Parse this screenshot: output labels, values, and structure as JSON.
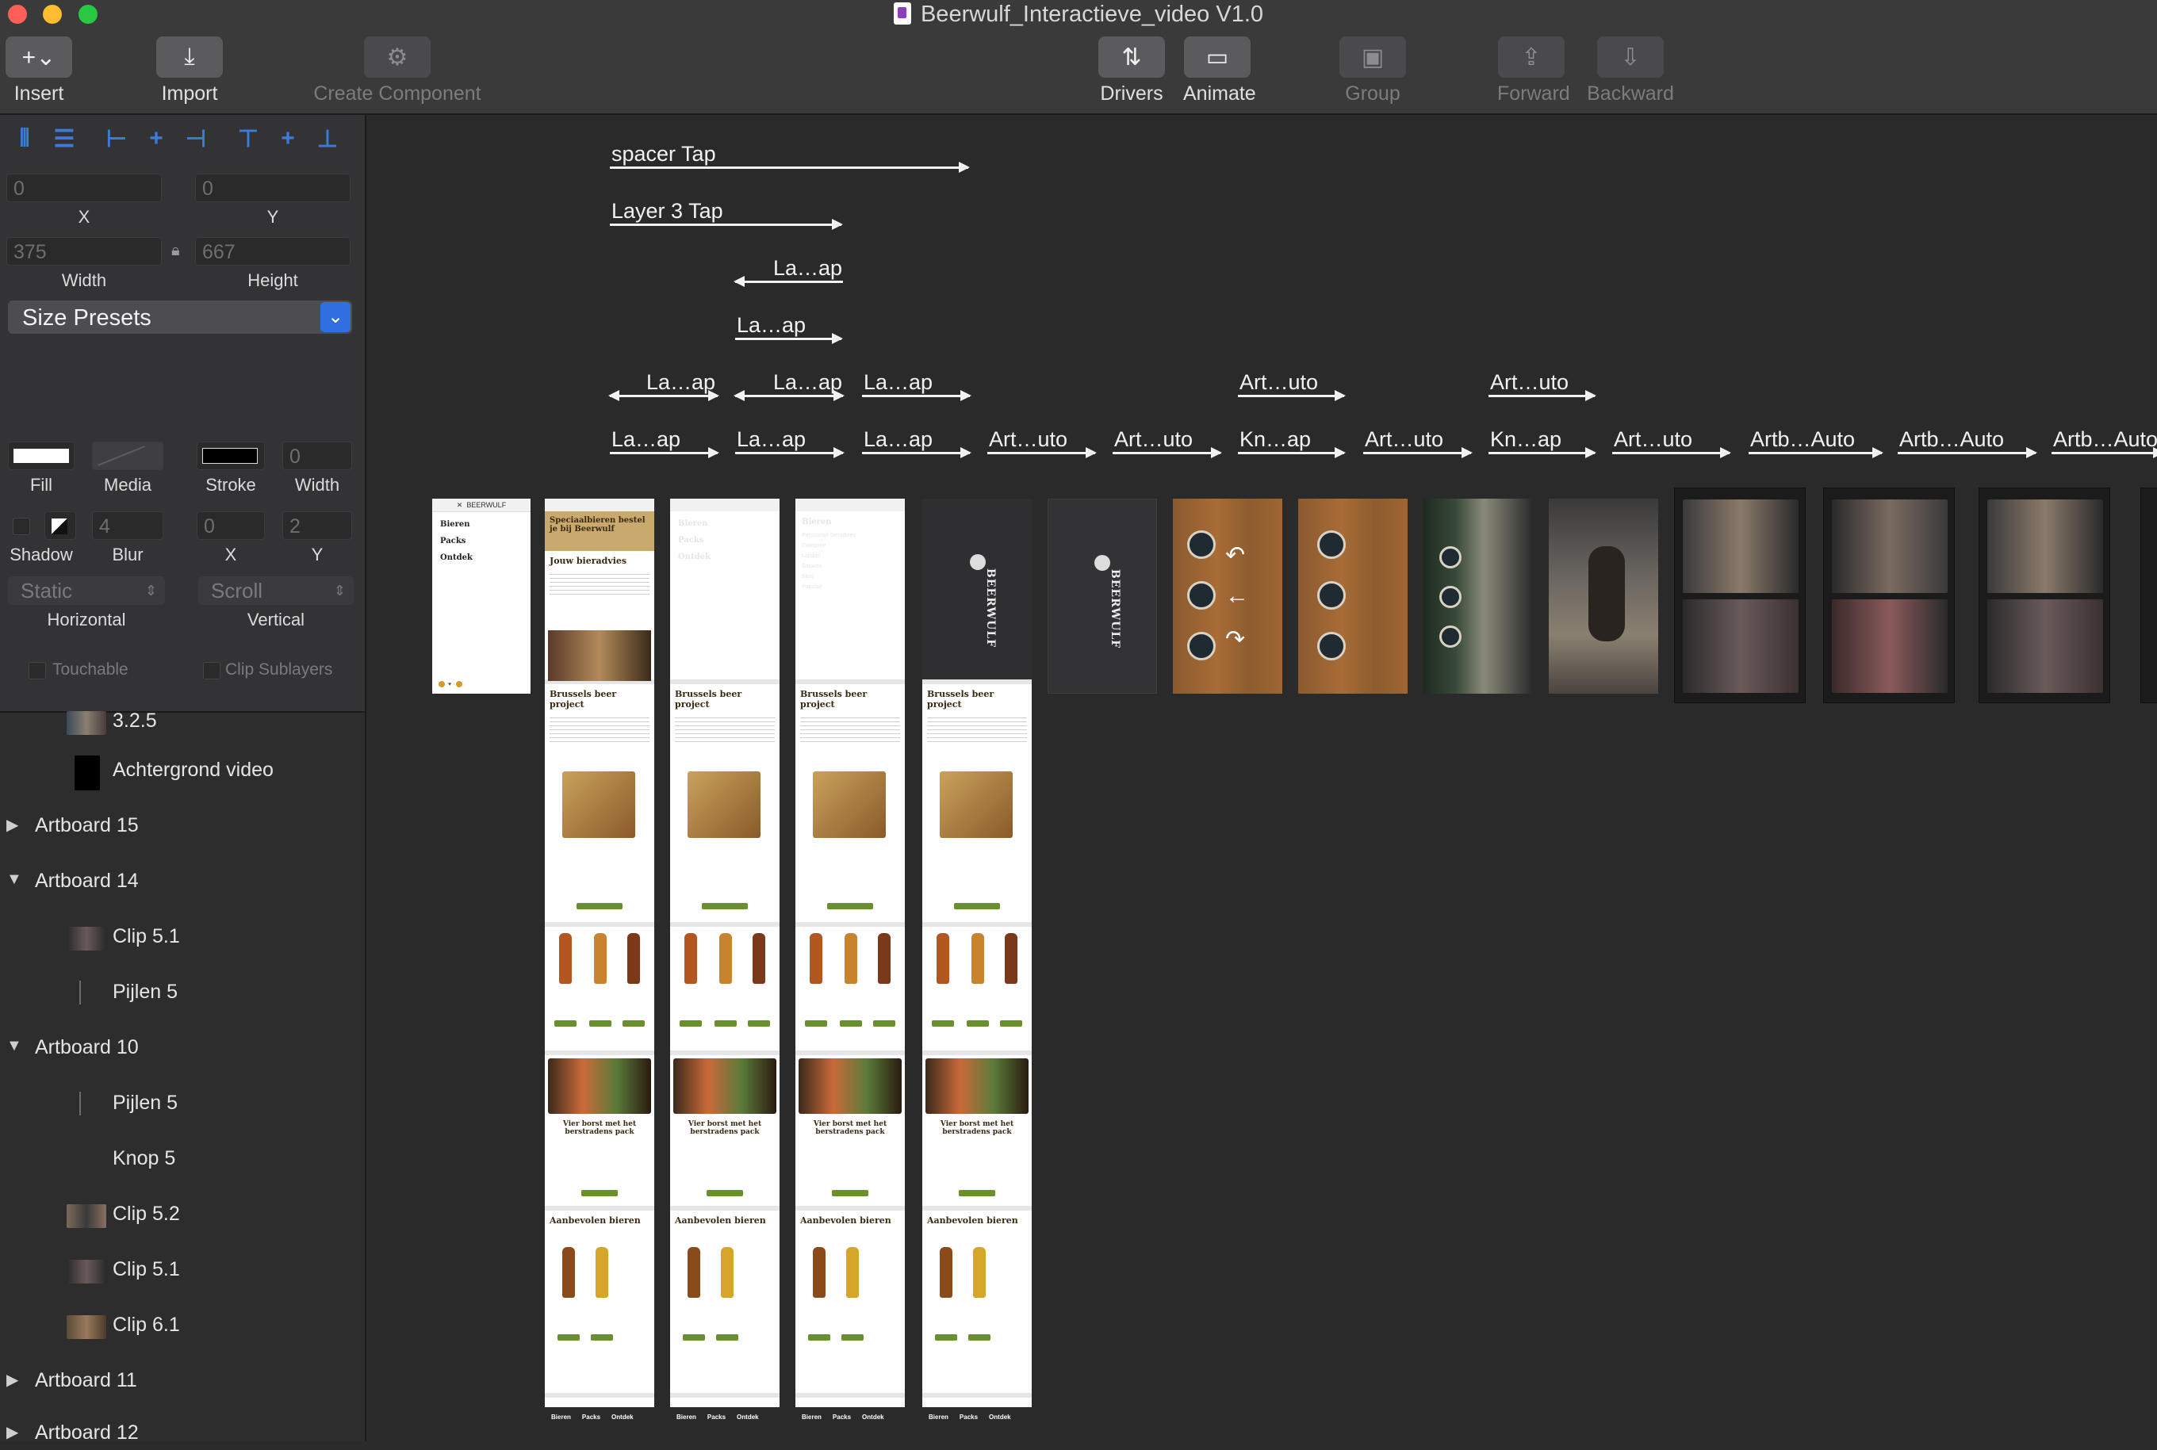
{
  "window": {
    "title": "Beerwulf_Interactieve_video V1.0"
  },
  "toolbar": {
    "insert": "Insert",
    "import": "Import",
    "create_component": "Create Component",
    "drivers": "Drivers",
    "animate": "Animate",
    "group": "Group",
    "forward": "Forward",
    "backward": "Backward"
  },
  "inspector": {
    "x_value": "0",
    "y_value": "0",
    "x_label": "X",
    "y_label": "Y",
    "width_value": "375",
    "height_value": "667",
    "width_label": "Width",
    "height_label": "Height",
    "size_presets": "Size Presets",
    "fill_label": "Fill",
    "media_label": "Media",
    "stroke_label": "Stroke",
    "stroke_width_value": "0",
    "stroke_width_label": "Width",
    "shadow_label": "Shadow",
    "blur_label": "Blur",
    "blur_value": "4",
    "shadow_x_value": "0",
    "shadow_y_value": "2",
    "shadow_x_label": "X",
    "shadow_y_label": "Y",
    "horizontal_value": "Static",
    "vertical_value": "Scroll",
    "horizontal_label": "Horizontal",
    "vertical_label": "Vertical",
    "touchable_label": "Touchable",
    "clip_sublayers_label": "Clip Sublayers"
  },
  "layers": [
    {
      "label": "3.2.5",
      "type": "image"
    },
    {
      "label": "Achtergrond video",
      "type": "black"
    },
    {
      "label": "Artboard 15",
      "type": "artboard",
      "expanded": false
    },
    {
      "label": "Artboard 14",
      "type": "artboard",
      "expanded": true
    },
    {
      "label": "Clip 5.1",
      "type": "image"
    },
    {
      "label": "Pijlen 5",
      "type": "line"
    },
    {
      "label": "Artboard 10",
      "type": "artboard",
      "expanded": true
    },
    {
      "label": "Pijlen 5",
      "type": "line"
    },
    {
      "label": "Knop 5",
      "type": "none"
    },
    {
      "label": "Clip 5.2",
      "type": "image"
    },
    {
      "label": "Clip 5.1",
      "type": "image"
    },
    {
      "label": "Clip 6.1",
      "type": "image"
    },
    {
      "label": "Artboard 11",
      "type": "artboard",
      "expanded": false
    },
    {
      "label": "Artboard 12",
      "type": "artboard",
      "expanded": false
    }
  ],
  "connections": [
    {
      "label": "spacer Tap",
      "dir": "right"
    },
    {
      "label": "Layer 3 Tap",
      "dir": "right"
    },
    {
      "label": "La…ap",
      "dir": "left"
    },
    {
      "label": "La…ap",
      "dir": "right"
    },
    {
      "label": "La…ap",
      "dir": "both"
    },
    {
      "label": "La…ap",
      "dir": "both"
    },
    {
      "label": "La…ap",
      "dir": "right"
    },
    {
      "label": "Art…uto",
      "dir": "right"
    },
    {
      "label": "Art…uto",
      "dir": "right"
    },
    {
      "label": "La…ap",
      "dir": "right"
    },
    {
      "label": "La…ap",
      "dir": "right"
    },
    {
      "label": "La…ap",
      "dir": "right"
    },
    {
      "label": "Art…uto",
      "dir": "right"
    },
    {
      "label": "Art…uto",
      "dir": "right"
    },
    {
      "label": "Kn…ap",
      "dir": "right"
    },
    {
      "label": "Art…uto",
      "dir": "right"
    },
    {
      "label": "Kn…ap",
      "dir": "right"
    },
    {
      "label": "Art…uto",
      "dir": "right"
    },
    {
      "label": "Artb…Auto",
      "dir": "right"
    },
    {
      "label": "Artb…Auto",
      "dir": "right"
    },
    {
      "label": "Artb…Auto",
      "dir": "right"
    }
  ],
  "artboards": {
    "menu_items": [
      "Bieren",
      "Packs",
      "Ontdek"
    ],
    "page_sections": [
      "Brussels beer project",
      "Vier borst met het berstradens pack",
      "Aanbevolen bieren"
    ],
    "page_header": "Speciaalbieren bestel je bij Beerwulf",
    "page_advice": "Jouw bieradvies",
    "menu2_items": [
      "Bieren",
      "Persoonlijk bieradvies",
      "Categorie",
      "Landen",
      "Smaken",
      "Bijzo",
      "Populair"
    ],
    "brand": "BEERWULF",
    "footer_nav": [
      "Bieren",
      "Packs",
      "Ontdek"
    ]
  },
  "colors": {
    "accent_blue": "#2f6fe0",
    "canvas_bg": "#2a2a2b",
    "panel_bg": "#333335",
    "wood": "#a86c36",
    "green_button": "#6a8f2d"
  }
}
